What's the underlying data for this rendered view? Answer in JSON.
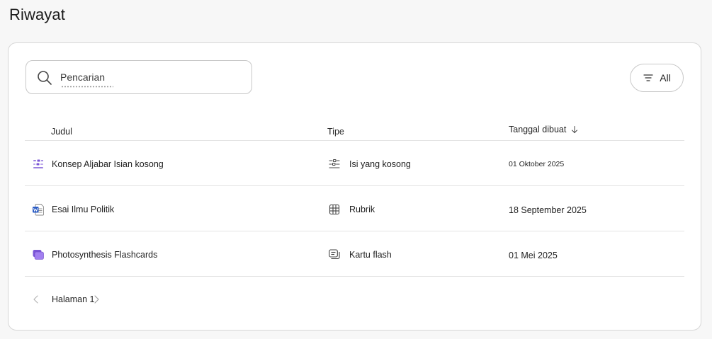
{
  "page": {
    "title": "Riwayat"
  },
  "search": {
    "placeholder": "Pencarian",
    "value": ""
  },
  "filter": {
    "label": "All"
  },
  "table": {
    "headers": {
      "title": "Judul",
      "type": "Tipe",
      "date": "Tanggal dibuat"
    },
    "rows": [
      {
        "title": "Konsep Aljabar Isian kosong",
        "title_icon": "fill-blank-icon",
        "type": "Isi yang kosong",
        "type_icon": "fill-blank-type-icon",
        "date": "01 Oktober 2025"
      },
      {
        "title": "Esai Ilmu Politik",
        "title_icon": "word-document-icon",
        "type": "Rubrik",
        "type_icon": "rubric-grid-icon",
        "date": "18 September 2025"
      },
      {
        "title": "Photosynthesis Flashcards",
        "title_icon": "flashcards-icon",
        "type": "Kartu flash",
        "type_icon": "flashcard-type-icon",
        "date": "01 Mei 2025"
      }
    ]
  },
  "pagination": {
    "label": "Halaman 1"
  },
  "colors": {
    "accent_purple": "#7b56d6",
    "word_blue": "#2b5cc4",
    "border": "#d6d6d6"
  }
}
